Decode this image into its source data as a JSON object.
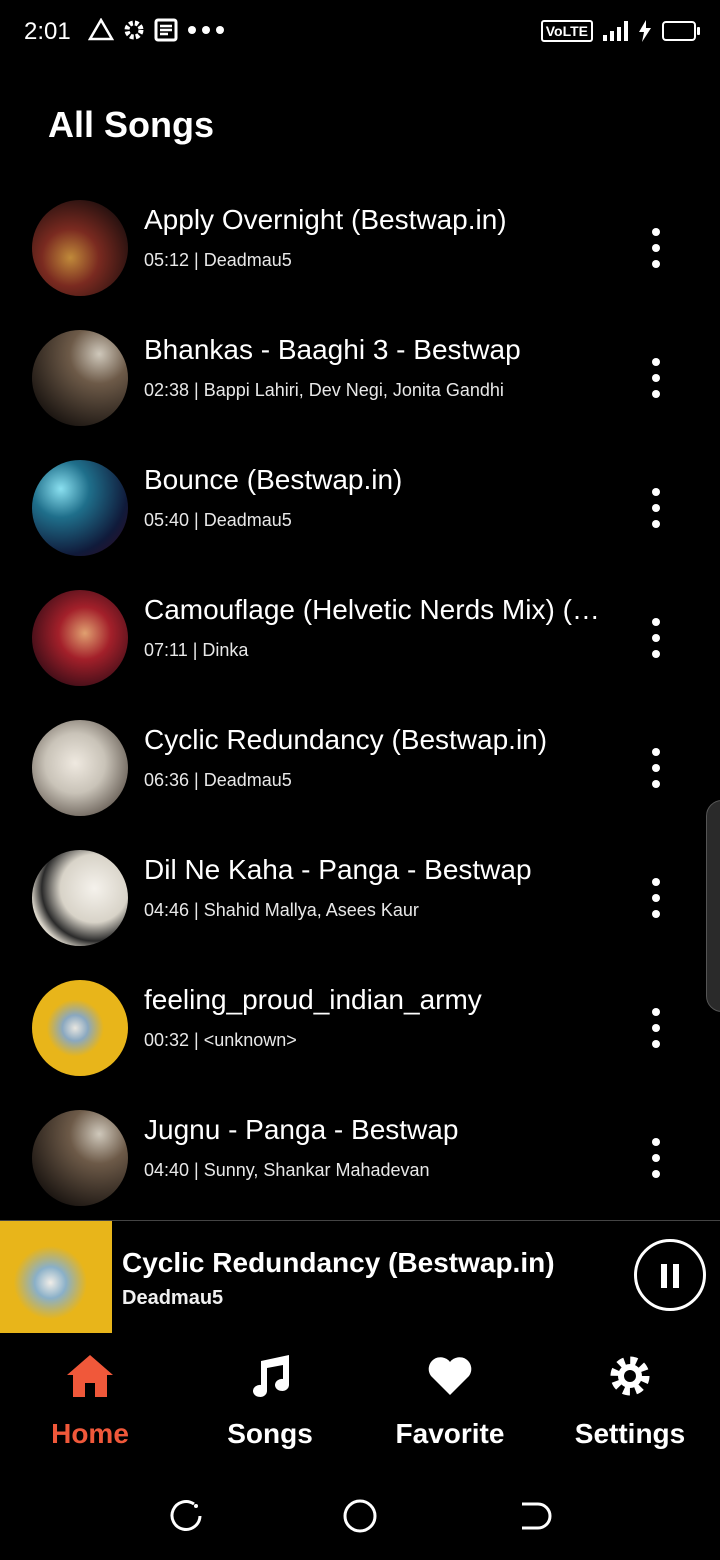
{
  "status_bar": {
    "time": "2:01",
    "volte": "VoLTE",
    "icons": [
      "alert-triangle-icon",
      "gear-icon",
      "news-icon",
      "more-dots-icon",
      "signal-icon",
      "charging-icon",
      "battery-icon"
    ]
  },
  "page": {
    "title": "All Songs"
  },
  "songs": [
    {
      "title": "Apply Overnight (Bestwap.in)",
      "meta": "05:12 | Deadmau5",
      "art": "#7a2a20"
    },
    {
      "title": "Bhankas - Baaghi 3 - Bestwap",
      "meta": "02:38 | Bappi Lahiri, Dev Negi, Jonita Gandhi",
      "art": "#5a4a3a"
    },
    {
      "title": "Bounce (Bestwap.in)",
      "meta": "05:40 | Deadmau5",
      "art": "#1f6f8b"
    },
    {
      "title": "Camouflage (Helvetic Nerds Mix) (Bestwap.in)",
      "meta": "07:11 | Dinka",
      "art": "#a3202a"
    },
    {
      "title": "Cyclic Redundancy (Bestwap.in)",
      "meta": "06:36 | Deadmau5",
      "art": "#c9c3b8"
    },
    {
      "title": "Dil Ne Kaha - Panga - Bestwap",
      "meta": "04:46 | Shahid Mallya, Asees Kaur",
      "art": "#d8d3c8"
    },
    {
      "title": "feeling_proud_indian_army",
      "meta": "00:32 | <unknown>",
      "art": "#e8b51a"
    },
    {
      "title": "Jugnu - Panga - Bestwap",
      "meta": "04:40 | Sunny, Shankar Mahadevan",
      "art": "#5a4a3a"
    }
  ],
  "now_playing": {
    "title": "Cyclic Redundancy (Bestwap.in)",
    "artist": "Deadmau5",
    "art": "#e8b51a"
  },
  "bottom_nav": [
    {
      "label": "Home",
      "active": true
    },
    {
      "label": "Songs",
      "active": false
    },
    {
      "label": "Favorite",
      "active": false
    },
    {
      "label": "Settings",
      "active": false
    }
  ],
  "colors": {
    "accent": "#f0583a",
    "background": "#000000",
    "text": "#ffffff"
  }
}
